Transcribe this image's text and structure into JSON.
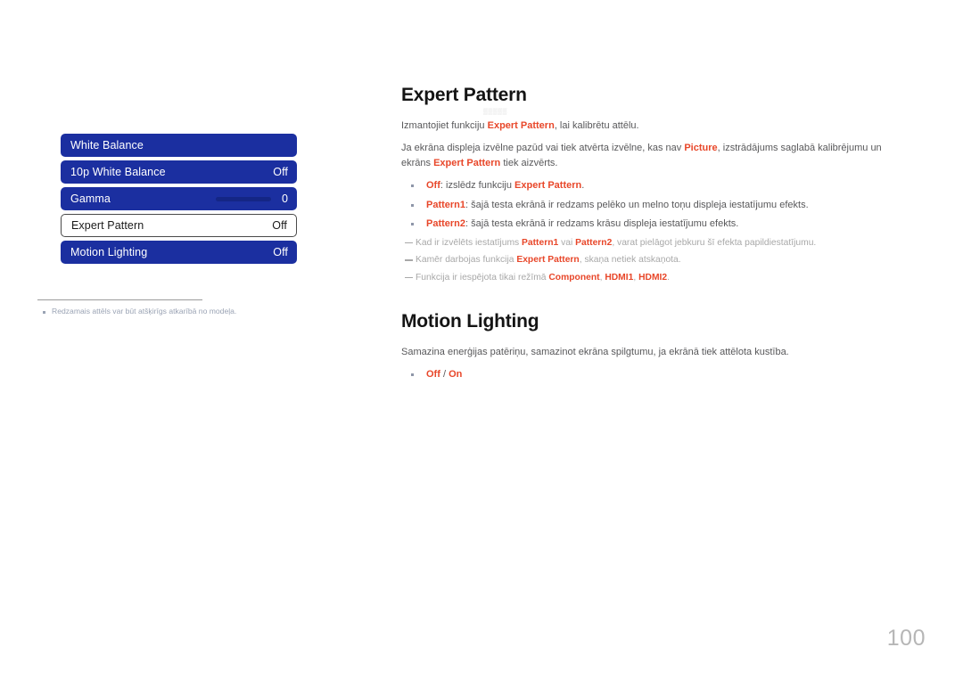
{
  "osd": {
    "rows": [
      {
        "label": "White Balance",
        "value": "",
        "selected": false,
        "slider": false
      },
      {
        "label": "10p White Balance",
        "value": "Off",
        "selected": false,
        "slider": false
      },
      {
        "label": "Gamma",
        "value": "0",
        "selected": false,
        "slider": true
      },
      {
        "label": "Expert Pattern",
        "value": "Off",
        "selected": true,
        "slider": false
      },
      {
        "label": "Motion Lighting",
        "value": "Off",
        "selected": false,
        "slider": false
      }
    ],
    "footnote": "Redzamais attēls var būt atšķirīgs atkarībā no modeļa."
  },
  "ghost_artifact": "▒▒▒▒▒",
  "sections": {
    "expert_pattern": {
      "title": "Expert Pattern",
      "intro_prefix": "Izmantojiet funkciju ",
      "intro_keyword": "Expert Pattern",
      "intro_suffix": ", lai kalibrētu attēlu.",
      "para2_part1": "Ja ekrāna displeja izvēlne pazūd vai tiek atvērta izvēlne, kas nav ",
      "para2_kw1": "Picture",
      "para2_part2": ", izstrādājums saglabā kalibrējumu un ekrāns ",
      "para2_kw2": "Expert Pattern",
      "para2_part3": " tiek aizvērts.",
      "bullets": [
        {
          "kw": "Off",
          "text_after_kw": ": izslēdz funkciju ",
          "kw2": "Expert Pattern",
          "tail": "."
        },
        {
          "kw": "Pattern1",
          "text_after_kw": ": šajā testa ekrānā ir redzams pelēko un melno toņu displeja iestatījumu efekts.",
          "kw2": "",
          "tail": ""
        },
        {
          "kw": "Pattern2",
          "text_after_kw": ": šajā testa ekrānā ir redzams krāsu displeja iestatījumu efekts.",
          "kw2": "",
          "tail": ""
        }
      ],
      "notes": [
        {
          "part1": "Kad ir izvēlēts iestatījums ",
          "kw1": "Pattern1",
          "part2": " vai ",
          "kw2": "Pattern2",
          "part3": ", varat pielāgot jebkuru šī efekta papildiestatījumu.",
          "kw3": "",
          "part4": ""
        },
        {
          "part1": "Kamēr darbojas funkcija ",
          "kw1": "Expert Pattern",
          "part2": ", skaņa netiek atskaņota.",
          "kw2": "",
          "part3": "",
          "kw3": "",
          "part4": ""
        },
        {
          "part1": "Funkcija ir iespējota tikai režīmā ",
          "kw1": "Component",
          "part2": ", ",
          "kw2": "HDMI1",
          "part3": ", ",
          "kw3": "HDMI2",
          "part4": "."
        }
      ]
    },
    "motion_lighting": {
      "title": "Motion Lighting",
      "para": "Samazina enerģijas patēriņu, samazinot ekrāna spilgtumu, ja ekrānā tiek attēlota kustība.",
      "option_off": "Off",
      "option_separator": " / ",
      "option_on": "On"
    }
  },
  "page_number": "100",
  "colors": {
    "osd_blue": "#1b2fa0",
    "keyword_red": "#e8472a",
    "body_gray": "#58585a",
    "note_gray": "#a8a8a8",
    "page_number_gray": "#b6b6b6"
  }
}
